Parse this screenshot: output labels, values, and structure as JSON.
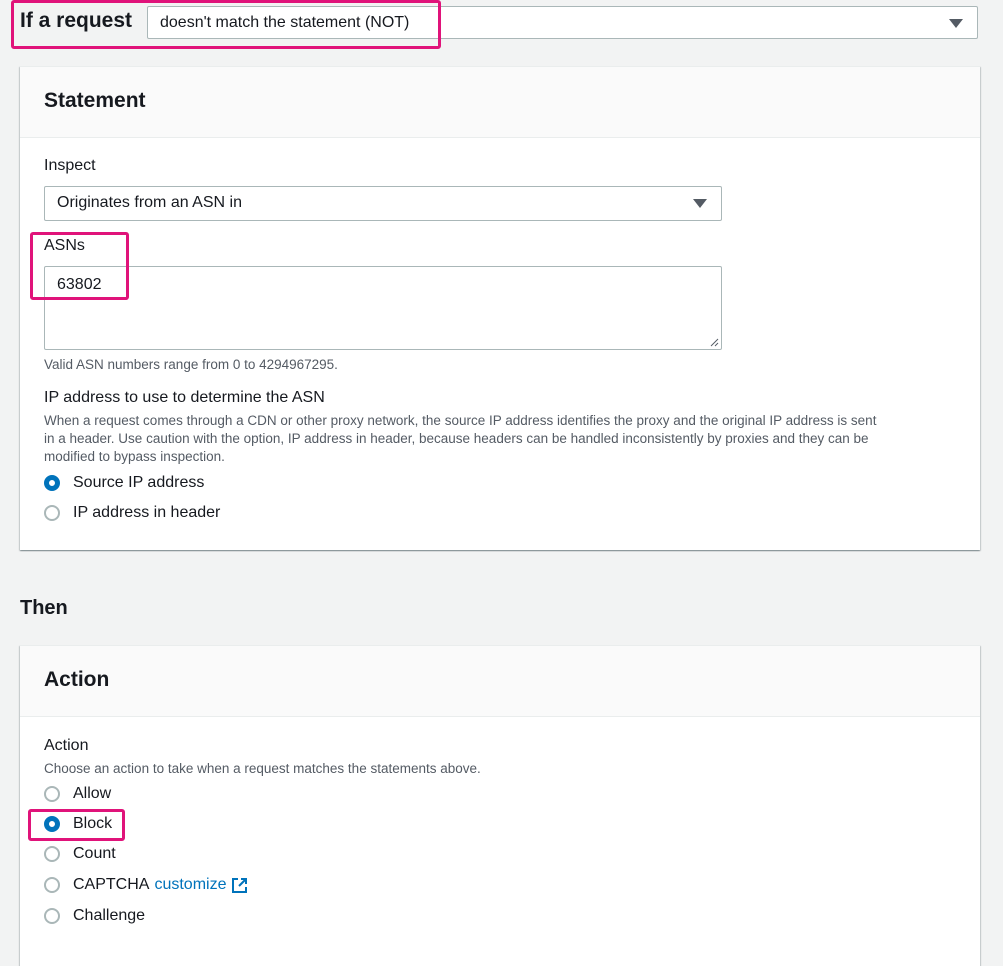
{
  "rule": {
    "if_label": "If a request",
    "match_option": "doesn't match the statement (NOT)"
  },
  "statement": {
    "title": "Statement",
    "inspect_label": "Inspect",
    "inspect_value": "Originates from an ASN in",
    "asns_label": "ASNs",
    "asns_value": "63802",
    "asns_hint": "Valid ASN numbers range from 0 to 4294967295.",
    "ip_source_label": "IP address to use to determine the ASN",
    "ip_source_desc_line1": "When a request comes through a CDN or other proxy network, the source IP address identifies the proxy and the original IP address is sent",
    "ip_source_desc_line2": "in a header. Use caution with the option, IP address in header, because headers can be handled inconsistently by proxies and they can be",
    "ip_source_desc_line3": "modified to bypass inspection.",
    "ip_options": [
      {
        "label": "Source IP address",
        "checked": true
      },
      {
        "label": "IP address in header",
        "checked": false
      }
    ]
  },
  "then": {
    "heading": "Then"
  },
  "action": {
    "title": "Action",
    "field_label": "Action",
    "field_desc": "Choose an action to take when a request matches the statements above.",
    "options": [
      {
        "label": "Allow",
        "checked": false
      },
      {
        "label": "Block",
        "checked": true
      },
      {
        "label": "Count",
        "checked": false
      },
      {
        "label": "CAPTCHA",
        "checked": false,
        "link": "customize"
      },
      {
        "label": "Challenge",
        "checked": false
      }
    ]
  },
  "colors": {
    "accent": "#0073bb",
    "highlight": "#e0137a",
    "background": "#f2f3f3"
  },
  "icons": {
    "dropdown": "caret-down-icon",
    "external_link": "external-link-icon"
  }
}
